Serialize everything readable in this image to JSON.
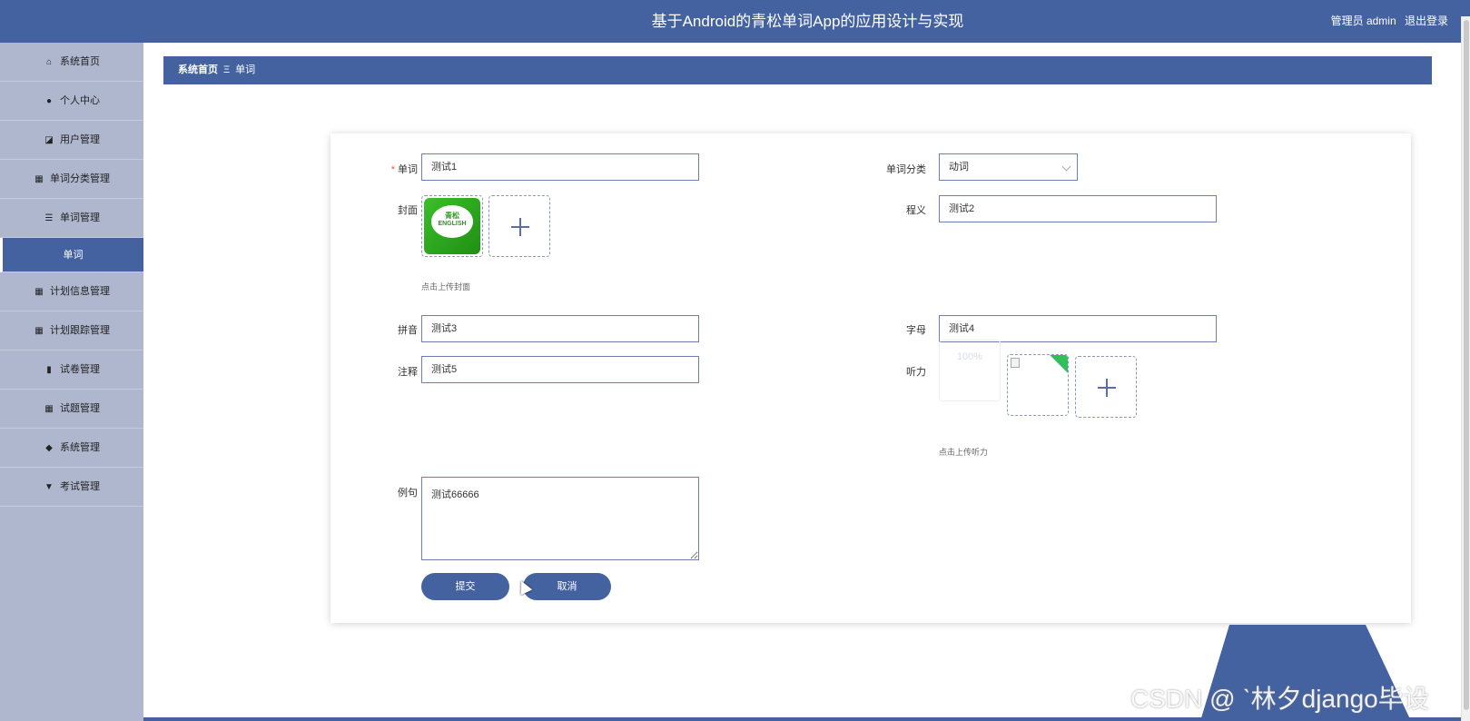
{
  "header": {
    "title": "基于Android的青松单词App的应用设计与实现",
    "role_label": "管理员 admin",
    "logout_label": "退出登录"
  },
  "sidebar": {
    "items": [
      {
        "label": "系统首页",
        "icon": "home-icon"
      },
      {
        "label": "个人中心",
        "icon": "user-icon"
      },
      {
        "label": "用户管理",
        "icon": "chart-icon"
      },
      {
        "label": "单词分类管理",
        "icon": "grid-icon"
      },
      {
        "label": "单词管理",
        "icon": "list-icon"
      },
      {
        "label": "单词",
        "icon": ""
      },
      {
        "label": "计划信息管理",
        "icon": "grid-icon"
      },
      {
        "label": "计划跟踪管理",
        "icon": "grid-icon"
      },
      {
        "label": "试卷管理",
        "icon": "bar-chart-icon"
      },
      {
        "label": "试题管理",
        "icon": "grid-icon"
      },
      {
        "label": "系统管理",
        "icon": "pin-icon"
      },
      {
        "label": "考试管理",
        "icon": "flag-icon"
      }
    ]
  },
  "breadcrumb": {
    "home": "系统首页",
    "separator": "Ξ",
    "current": "单词"
  },
  "form": {
    "word_label": "单词",
    "word_value": "测试1",
    "category_label": "单词分类",
    "category_value": "动词",
    "cover_label": "封面",
    "cover_image_text1": "青松",
    "cover_image_text2": "ENGLISH",
    "cover_hint": "点击上传封面",
    "definition_label": "程义",
    "definition_value": "测试2",
    "pinyin_label": "拼音",
    "pinyin_value": "测试3",
    "letter_label": "字母",
    "letter_value": "测试4",
    "note_label": "注释",
    "note_value": "测试5",
    "listening_label": "听力",
    "listening_progress": "100%",
    "listening_hint": "点击上传听力",
    "example_label": "例句",
    "example_value": "测试66666",
    "submit_label": "提交",
    "cancel_label": "取消"
  },
  "watermark": "CSDN @ ˋ林夕django毕设",
  "colors": {
    "primary": "#4462a0",
    "sidebar_bg": "#aeb7ce",
    "required": "#e54"
  }
}
